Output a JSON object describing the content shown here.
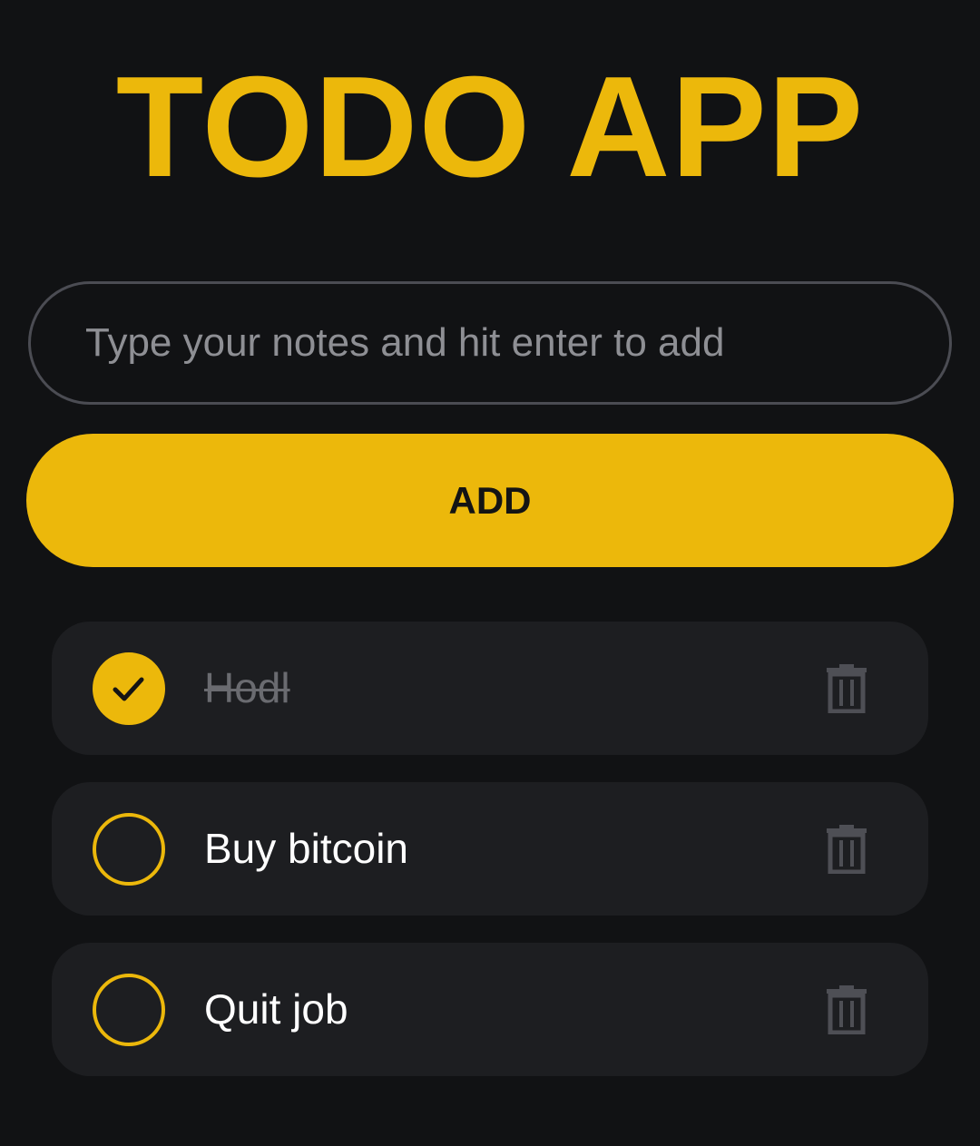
{
  "app": {
    "title": "TODO APP",
    "accent_color": "#ecb80b",
    "background_color": "#111214"
  },
  "input": {
    "placeholder": "Type your notes and hit enter to add",
    "value": ""
  },
  "add_button": {
    "label": "ADD"
  },
  "todos": [
    {
      "text": "Hodl",
      "done": true,
      "check_icon": "check-icon",
      "delete_icon": "trash-icon"
    },
    {
      "text": "Buy bitcoin",
      "done": false,
      "check_icon": "empty-circle-icon",
      "delete_icon": "trash-icon"
    },
    {
      "text": "Quit job",
      "done": false,
      "check_icon": "empty-circle-icon",
      "delete_icon": "trash-icon"
    }
  ]
}
